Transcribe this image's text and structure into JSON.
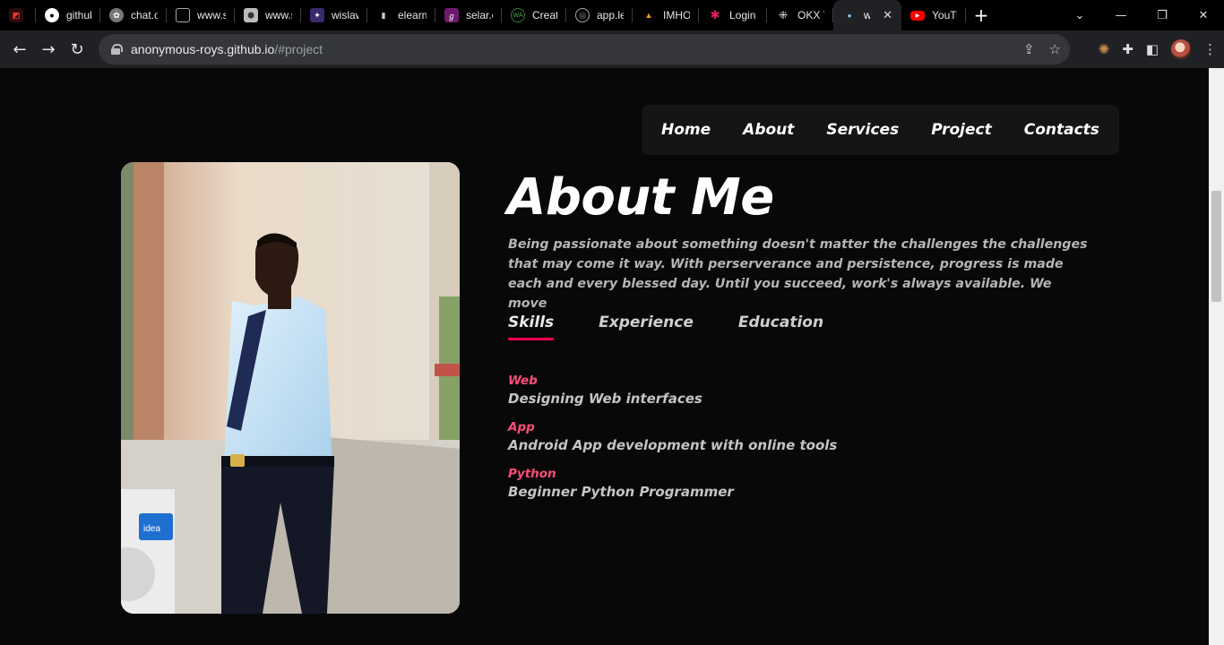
{
  "browser": {
    "tabs": [
      {
        "label": "",
        "icon": "pdf-icon",
        "color": "#e53935"
      },
      {
        "label": "github",
        "icon": "github-icon",
        "color": "#ffffff"
      },
      {
        "label": "chat.o",
        "icon": "chatgpt-icon",
        "color": "#9e9e9e"
      },
      {
        "label": "www.s",
        "icon": "page-icon",
        "color": "#9e9e9e"
      },
      {
        "label": "www.s",
        "icon": "cube-icon",
        "color": "#bdbdbd"
      },
      {
        "label": "wislaw",
        "icon": "wislaw-icon",
        "color": "#7e57c2"
      },
      {
        "label": "elearn",
        "icon": "doc-icon",
        "color": "#bdbdbd"
      },
      {
        "label": "selar.c",
        "icon": "selar-icon",
        "color": "#a21caf"
      },
      {
        "label": "Create",
        "icon": "wa-icon",
        "color": "#1b5e20"
      },
      {
        "label": "app.le",
        "icon": "app-icon",
        "color": "#9e9e9e"
      },
      {
        "label": "IMHO",
        "icon": "flame-icon",
        "color": "#ff9800"
      },
      {
        "label": "Login",
        "icon": "slack-icon",
        "color": "#e91e63"
      },
      {
        "label": "OKX Tr",
        "icon": "okx-icon",
        "color": "#ffffff"
      },
      {
        "label": "ww",
        "icon": "person-icon",
        "color": "#90caf9",
        "active": true
      },
      {
        "label": "YouTu",
        "icon": "youtube-icon",
        "color": "#ff0000"
      }
    ],
    "url_host": "anonymous-roys.github.io",
    "url_path": "/#project"
  },
  "nav": {
    "items": [
      "Home",
      "About",
      "Services",
      "Project",
      "Contacts"
    ]
  },
  "about": {
    "title": "About Me",
    "text": "Being passionate about something doesn't matter the challenges the challenges that may come it way. With perserverance and persistence, progress is made each and every blessed day. Until you succeed, work's always available. We move",
    "tabs": [
      {
        "label": "Skills",
        "active": true
      },
      {
        "label": "Experience"
      },
      {
        "label": "Education"
      }
    ],
    "skills": [
      {
        "name": "Web",
        "desc": "Designing Web interfaces"
      },
      {
        "name": "App",
        "desc": "Android App development with online tools"
      },
      {
        "name": "Python",
        "desc": "Beginner Python Programmer"
      }
    ]
  },
  "colors": {
    "accent": "#ff004f",
    "skill_name": "#ff4d79",
    "background": "#080808"
  }
}
